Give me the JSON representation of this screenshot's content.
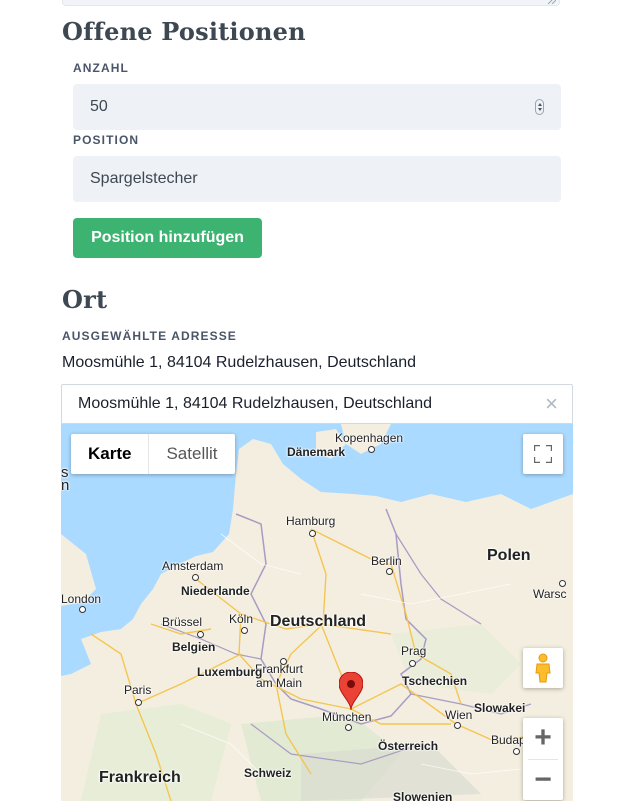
{
  "openings": {
    "title": "Offene Positionen",
    "count_label": "ANZAHL",
    "count_value": "50",
    "position_label": "POSITION",
    "position_value": "Spargelstecher",
    "add_button": "Position hinzufügen"
  },
  "location": {
    "title": "Ort",
    "selected_label": "AUSGEWÄHLTE ADRESSE",
    "selected_address": "Moosmühle 1, 84104 Rudelzhausen, Deutschland",
    "search_value": "Moosmühle 1, 84104 Rudelzhausen, Deutschland",
    "clear_icon": "×"
  },
  "map": {
    "type_map": "Karte",
    "type_satellite": "Satellit",
    "zoom_in": "+",
    "zoom_out": "−",
    "colors": {
      "water": "#aadaff",
      "land": "#f5f0e1",
      "marker": "#ea4335"
    },
    "countries": {
      "germany": "Deutschland",
      "poland": "Polen",
      "czechia": "Tschechien",
      "france": "Frankreich",
      "denmark": "Dänemark"
    },
    "cities": {
      "copenhagen": "Kopenhagen",
      "hamburg": "Hamburg",
      "berlin": "Berlin",
      "amsterdam": "Amsterdam",
      "netherlands": "Niederlande",
      "london": "London",
      "brussels": "Brüssel",
      "belgium": "Belgien",
      "cologne": "Köln",
      "frankfurt": "Frankfurt\nam Main",
      "luxembourg": "Luxemburg",
      "prague": "Prag",
      "paris": "Paris",
      "munich": "München",
      "vienna": "Wien",
      "slovakia": "Slowakei",
      "budapest": "Budap",
      "austria": "Österreich",
      "switzerland": "Schweiz",
      "slovenia": "Slowenien",
      "warsaw": "Warsc",
      "edge_s": "s",
      "edge_n": "n"
    }
  }
}
